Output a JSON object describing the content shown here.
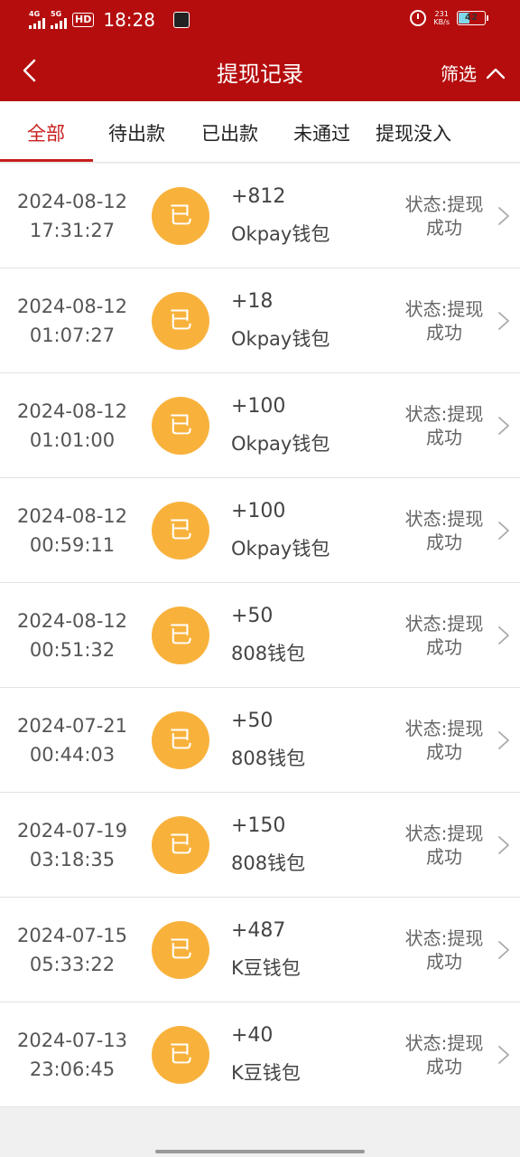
{
  "status_bar": {
    "signal1": "4G",
    "signal2": "5G",
    "hd": "HD",
    "time": "18:28",
    "netspeed_value": "231",
    "netspeed_unit": "KB/s",
    "battery_level": "42"
  },
  "header": {
    "title": "提现记录",
    "filter_label": "筛选"
  },
  "tabs": [
    {
      "label": "全部"
    },
    {
      "label": "待出款"
    },
    {
      "label": "已出款"
    },
    {
      "label": "未通过"
    },
    {
      "label": "提现没入"
    }
  ],
  "active_tab": "全部",
  "colors": {
    "brand": "#b50d0d",
    "accent": "#c8201e",
    "badge": "#f8b23c"
  },
  "records": [
    {
      "date": "2024-08-12",
      "time": "17:31:27",
      "badge": "已",
      "amount": "+812",
      "wallet": "Okpay钱包",
      "status_line1": "状态:提现",
      "status_line2": "成功"
    },
    {
      "date": "2024-08-12",
      "time": "01:07:27",
      "badge": "已",
      "amount": "+18",
      "wallet": "Okpay钱包",
      "status_line1": "状态:提现",
      "status_line2": "成功"
    },
    {
      "date": "2024-08-12",
      "time": "01:01:00",
      "badge": "已",
      "amount": "+100",
      "wallet": "Okpay钱包",
      "status_line1": "状态:提现",
      "status_line2": "成功"
    },
    {
      "date": "2024-08-12",
      "time": "00:59:11",
      "badge": "已",
      "amount": "+100",
      "wallet": "Okpay钱包",
      "status_line1": "状态:提现",
      "status_line2": "成功"
    },
    {
      "date": "2024-08-12",
      "time": "00:51:32",
      "badge": "已",
      "amount": "+50",
      "wallet": "808钱包",
      "status_line1": "状态:提现",
      "status_line2": "成功"
    },
    {
      "date": "2024-07-21",
      "time": "00:44:03",
      "badge": "已",
      "amount": "+50",
      "wallet": "808钱包",
      "status_line1": "状态:提现",
      "status_line2": "成功"
    },
    {
      "date": "2024-07-19",
      "time": "03:18:35",
      "badge": "已",
      "amount": "+150",
      "wallet": "808钱包",
      "status_line1": "状态:提现",
      "status_line2": "成功"
    },
    {
      "date": "2024-07-15",
      "time": "05:33:22",
      "badge": "已",
      "amount": "+487",
      "wallet": "K豆钱包",
      "status_line1": "状态:提现",
      "status_line2": "成功"
    },
    {
      "date": "2024-07-13",
      "time": "23:06:45",
      "badge": "已",
      "amount": "+40",
      "wallet": "K豆钱包",
      "status_line1": "状态:提现",
      "status_line2": "成功"
    }
  ]
}
